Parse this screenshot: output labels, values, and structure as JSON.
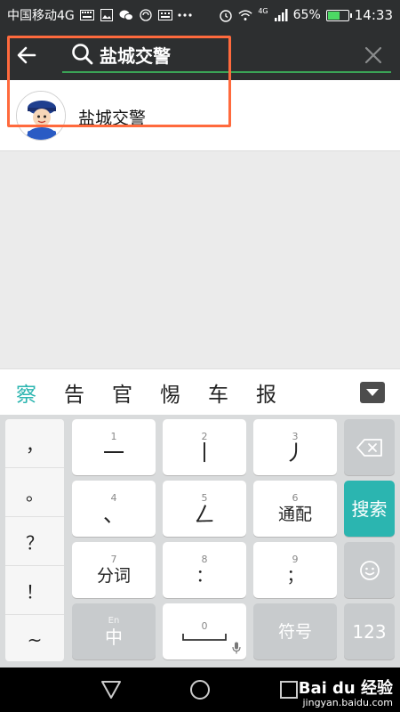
{
  "status_bar": {
    "carrier": "中国移动4G",
    "network_small": "4G",
    "battery_percent": "65%",
    "battery_level": 0.65,
    "time": "14:33",
    "icons": [
      "keyboard-icon",
      "image-icon",
      "wechat-icon",
      "sync-icon",
      "keyboard-icon",
      "more-icon",
      "alarm-icon",
      "wifi-icon",
      "signal-icon",
      "battery-icon"
    ]
  },
  "search": {
    "back_icon": "back-arrow-icon",
    "search_icon": "search-icon",
    "query": "盐城交警",
    "clear_icon": "close-icon",
    "accent_color": "#3aa356"
  },
  "results": [
    {
      "name": "盐城交警",
      "avatar_caption": "盐城交警"
    }
  ],
  "highlight_color": "#ff6a3d",
  "ime": {
    "candidates": [
      "察",
      "告",
      "官",
      "惕",
      "车",
      "报"
    ],
    "collapse_icon": "chevron-down-icon",
    "punctuation": [
      "，",
      "。",
      "？",
      "！",
      "~"
    ],
    "keys": {
      "k1": {
        "num": "1",
        "label": "一"
      },
      "k2": {
        "num": "2",
        "label": "丨"
      },
      "k3": {
        "num": "3",
        "label": "丿"
      },
      "k4": {
        "num": "4",
        "label": "、"
      },
      "k5": {
        "num": "5",
        "label": "ㄥ"
      },
      "k6": {
        "num": "6",
        "label": "通配"
      },
      "k7": {
        "num": "7",
        "label": "分词"
      },
      "k8": {
        "num": "8",
        "label": "："
      },
      "k9": {
        "num": "9",
        "label": "；"
      },
      "k0": {
        "num": "0"
      },
      "lang": {
        "sub": "En",
        "label": "中"
      },
      "symbols": {
        "label": "符号"
      },
      "numbers": {
        "label": "123"
      },
      "search": {
        "label": "搜索"
      }
    },
    "accent_color": "#2bb5b0"
  },
  "nav": {
    "icons": [
      "back-triangle-icon",
      "home-circle-icon",
      "recents-square-icon"
    ]
  },
  "watermark": {
    "main": "Bai du 经验",
    "sub": "jingyan.baidu.com"
  }
}
